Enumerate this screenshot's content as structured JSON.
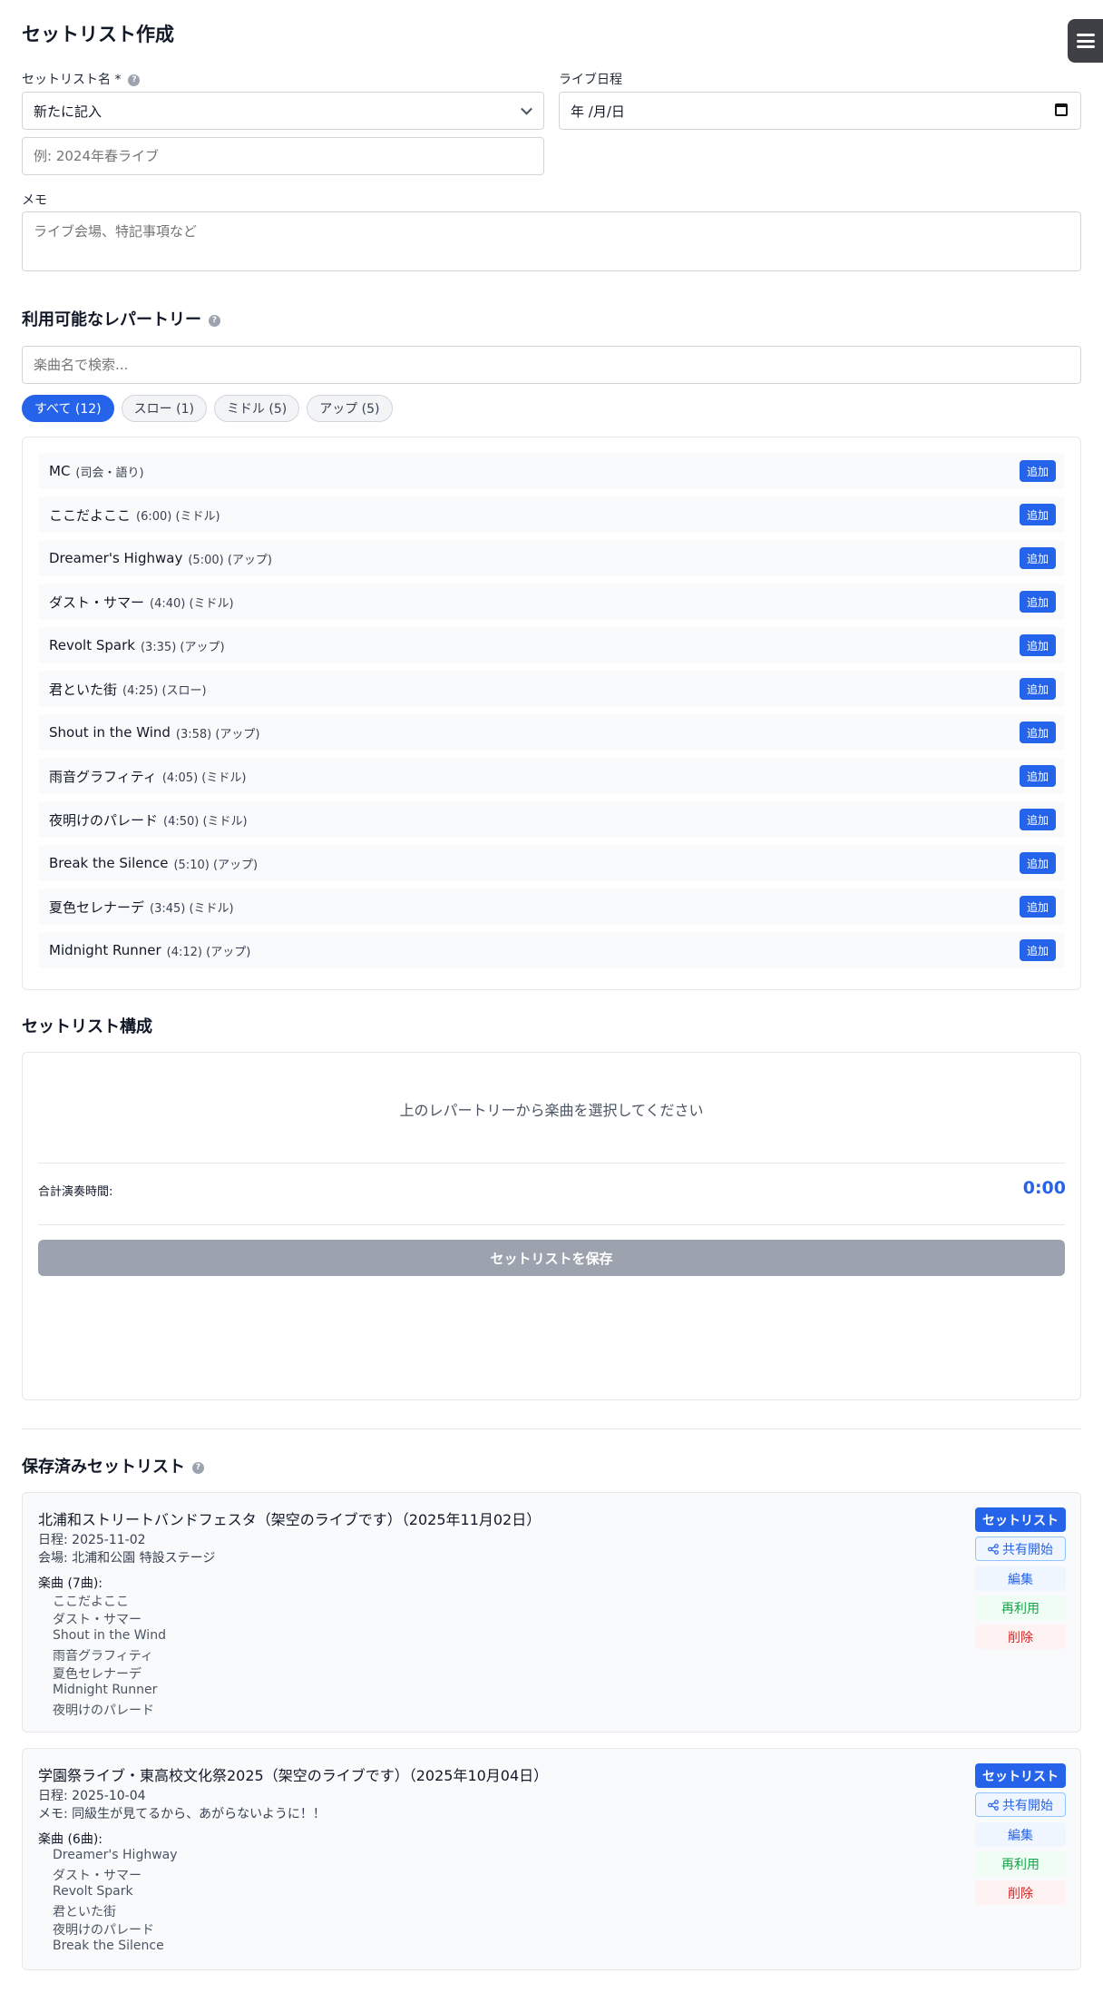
{
  "header": {
    "title": "セットリスト作成"
  },
  "form": {
    "name_label": "セットリスト名 *",
    "name_select_value": "新たに記入",
    "name_placeholder": "例: 2024年春ライブ",
    "date_label": "ライブ日程",
    "date_value": "年 /月/日",
    "memo_label": "メモ",
    "memo_placeholder": "ライブ会場、特記事項など"
  },
  "repertoire": {
    "title": "利用可能なレパートリー",
    "search_placeholder": "楽曲名で検索...",
    "filters": [
      "すべて (12)",
      "スロー (1)",
      "ミドル (5)",
      "アップ (5)"
    ],
    "active_filter": 0,
    "add_label": "追加",
    "songs": [
      {
        "name": "MC",
        "meta": "(司会・語り)"
      },
      {
        "name": "ここだよここ",
        "meta": "(6:00) (ミドル)"
      },
      {
        "name": "Dreamer's Highway",
        "meta": "(5:00) (アップ)"
      },
      {
        "name": "ダスト・サマー",
        "meta": "(4:40) (ミドル)"
      },
      {
        "name": "Revolt Spark",
        "meta": "(3:35) (アップ)"
      },
      {
        "name": "君といた街",
        "meta": "(4:25) (スロー)"
      },
      {
        "name": "Shout in the Wind",
        "meta": "(3:58) (アップ)"
      },
      {
        "name": "雨音グラフィティ",
        "meta": "(4:05) (ミドル)"
      },
      {
        "name": "夜明けのパレード",
        "meta": "(4:50) (ミドル)"
      },
      {
        "name": "Break the Silence",
        "meta": "(5:10) (アップ)"
      },
      {
        "name": "夏色セレナーデ",
        "meta": "(3:45) (ミドル)"
      },
      {
        "name": "Midnight Runner",
        "meta": "(4:12) (アップ)"
      }
    ]
  },
  "setlist": {
    "title": "セットリスト構成",
    "empty_message": "上のレパートリーから楽曲を選択してください",
    "total_label": "合計演奏時間:",
    "total_value": "0:00",
    "save_label": "セットリストを保存"
  },
  "saved": {
    "title": "保存済みセットリスト",
    "actions": {
      "setlist": "セットリスト",
      "share": "共有開始",
      "edit": "編集",
      "reuse": "再利用",
      "delete": "削除"
    },
    "items": [
      {
        "title": "北浦和ストリートバンドフェスタ（架空のライブです）（2025年11月02日）",
        "date": "日程: 2025-11-02",
        "note": "会場: 北浦和公園 特設ステージ",
        "songs_label": "楽曲 (7曲):",
        "songs": [
          "ここだよここ",
          "ダスト・サマー",
          "Shout in the Wind",
          "雨音グラフィティ",
          "夏色セレナーデ",
          "Midnight Runner",
          "夜明けのパレード"
        ]
      },
      {
        "title": "学園祭ライブ・東高校文化祭2025（架空のライブです）（2025年10月04日）",
        "date": "日程: 2025-10-04",
        "note": "メモ: 同級生が見てるから、あがらないように！！",
        "songs_label": "楽曲 (6曲):",
        "songs": [
          "Dreamer's Highway",
          "ダスト・サマー",
          "Revolt Spark",
          "君といた街",
          "夜明けのパレード",
          "Break the Silence"
        ]
      }
    ]
  }
}
